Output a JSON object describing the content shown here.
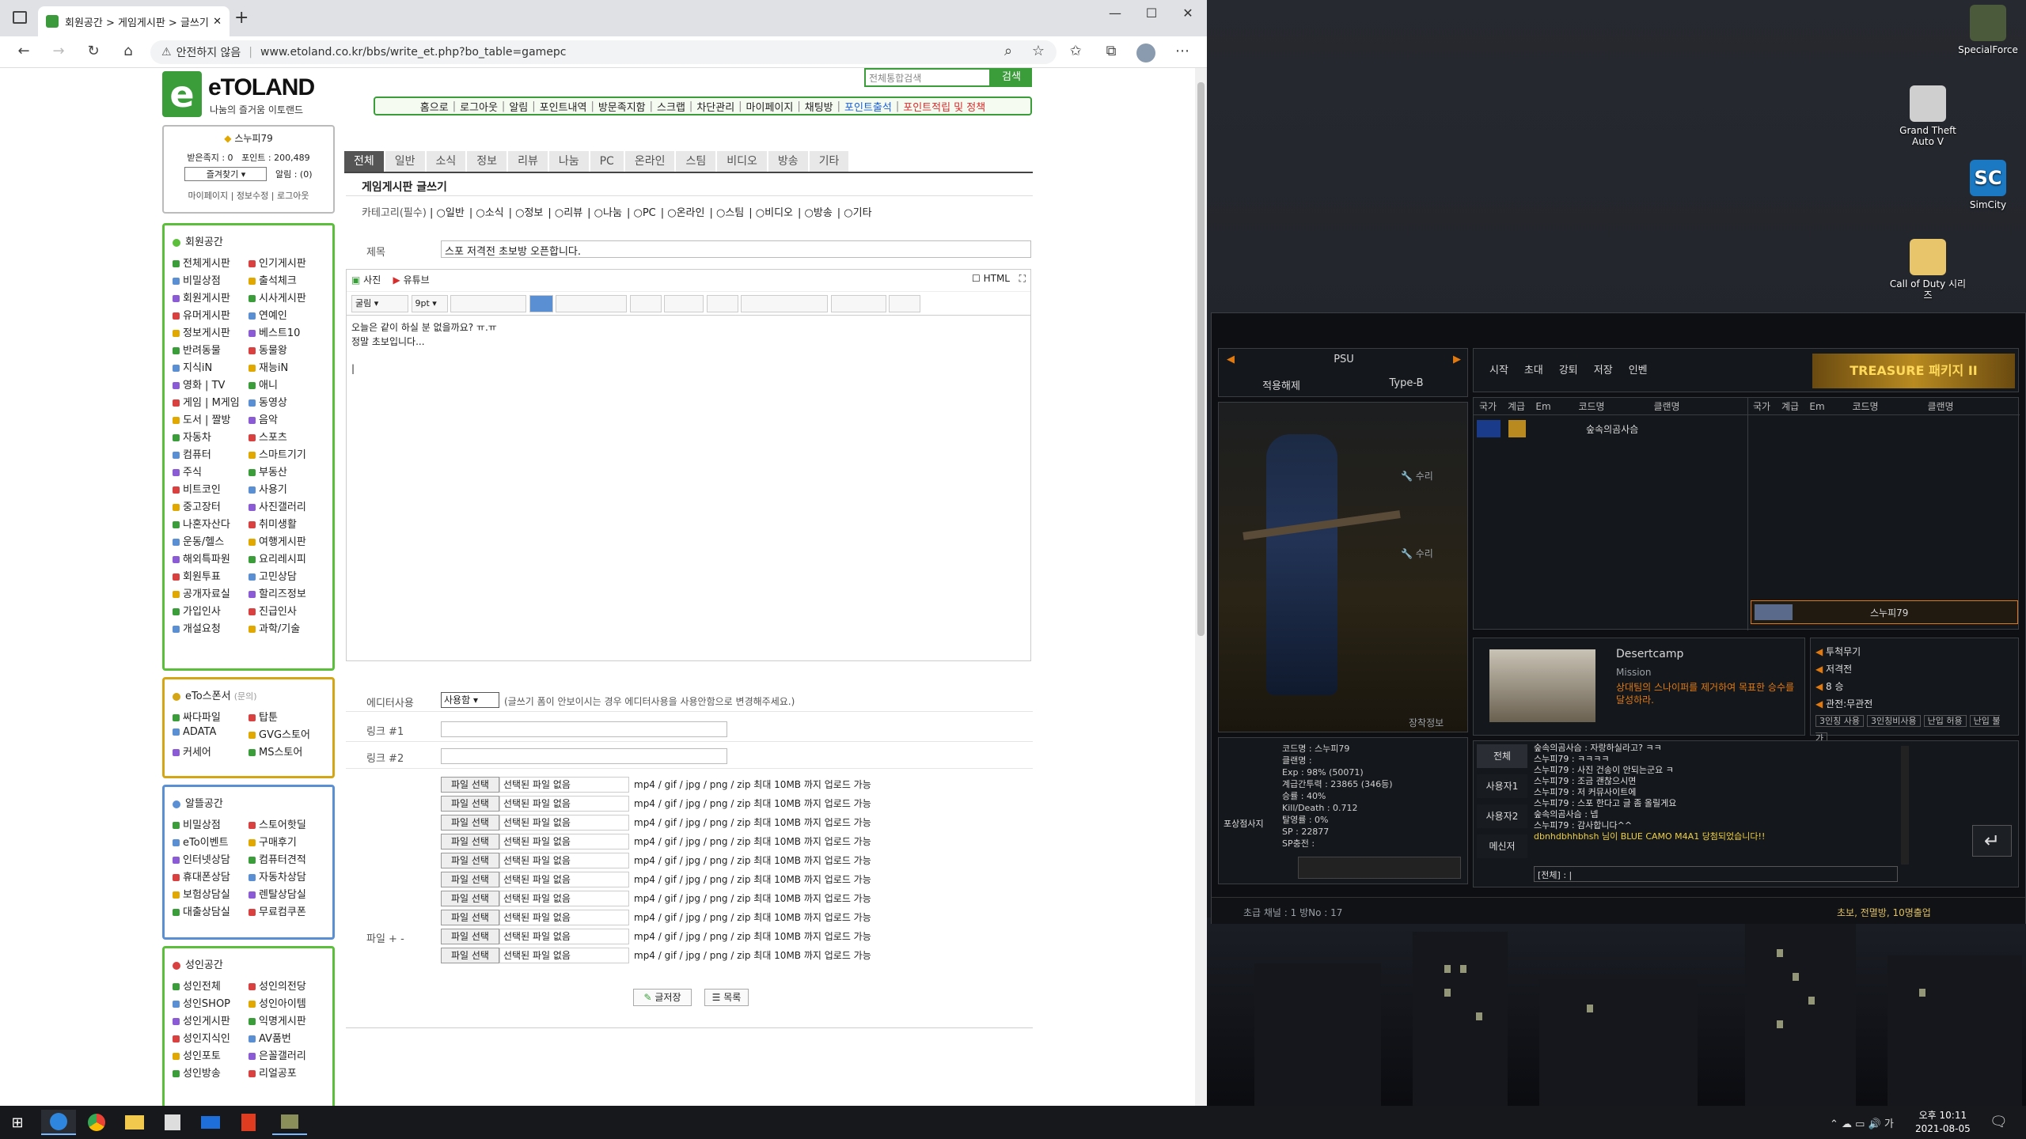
{
  "browser": {
    "tab_title": "회원공간 > 게임게시판 > 글쓰기",
    "new_tab": "+",
    "url_warning": "안전하지 않음",
    "url": "www.etoland.co.kr/bbs/write_et.php?bo_table=gamepc"
  },
  "site": {
    "logo_letter": "e",
    "logo_name": "eTOLAND",
    "logo_sub": "나눔의 즐거움 이토랜드",
    "search_placeholder": "전체통합검색",
    "search_button": "검색",
    "nav": [
      "홈으로",
      "로그아웃",
      "알림",
      "포인트내역",
      "방문족지함",
      "스크랩",
      "차단관리",
      "마이페이지",
      "채팅방",
      "포인트출석",
      "포인트적립 및 정책"
    ]
  },
  "user": {
    "name": "스누피79",
    "received_label": "받은족지 : 0",
    "points_label": "포인트 : 200,489",
    "favorites": "즐겨찾기",
    "alerts": "알림 : (0)",
    "links": "마이페이지 | 정보수정 | 로그아웃"
  },
  "sidebar": {
    "member": {
      "title": "회원공간",
      "items": [
        "전체게시판",
        "인기게시판",
        "비밀상점",
        "출석체크",
        "회원게시판",
        "시사게시판",
        "유머게시판",
        "연예인",
        "정보게시판",
        "베스트10",
        "반려동물",
        "동물왕",
        "지식iN",
        "재능iN",
        "영화 | TV",
        "애니",
        "게임 | M게임",
        "동영상",
        "도서 | 짤방",
        "음악",
        "자동차",
        "스포츠",
        "컴퓨터",
        "스마트기기",
        "주식",
        "부동산",
        "비트코인",
        "사용기",
        "중고장터",
        "사진갤러리",
        "나혼자산다",
        "취미생활",
        "운동/헬스",
        "여행게시판",
        "해외특파원",
        "요리레시피",
        "회원투표",
        "고민상담",
        "공개자료실",
        "할리즈정보",
        "가입인사",
        "진급인사",
        "개설요청",
        "과학/기술"
      ]
    },
    "sponsor": {
      "title": "eTo스폰서",
      "sub": "(문의)",
      "items": [
        "싸다파일",
        "탑툰",
        "ADATA",
        "GVG스토어",
        "커세어",
        "MS스토어"
      ]
    },
    "deals": {
      "title": "알뜰공간",
      "items": [
        "비밀상점",
        "스토어핫딜",
        "eTo이벤트",
        "구매후기",
        "인터넷상담",
        "컴퓨터견적",
        "휴대폰상담",
        "자동차상담",
        "보험상담실",
        "렌탈상담실",
        "대출상담실",
        "무료컴쿠폰"
      ]
    },
    "adult": {
      "title": "성인공간",
      "items": [
        "성인전체",
        "성인의전당",
        "성인SHOP",
        "성인아이템",
        "성인게시판",
        "익명게시판",
        "성인지식인",
        "AV품번",
        "성인포토",
        "은꼴갤러리",
        "성인방송",
        "리얼공포"
      ]
    }
  },
  "board": {
    "tabs": [
      "전체",
      "일반",
      "소식",
      "정보",
      "리뷰",
      "나눔",
      "PC",
      "온라인",
      "스팀",
      "비디오",
      "방송",
      "기타"
    ],
    "heading": "게임게시판 글쓰기",
    "category_label": "카테고리(필수)",
    "categories": [
      "일반",
      "소식",
      "정보",
      "리뷰",
      "나눔",
      "PC",
      "온라인",
      "스팀",
      "비디오",
      "방송",
      "기타"
    ],
    "subject_label": "제목",
    "subject": "스포 저격전 초보방 오픈합니다.",
    "photo_btn": "사진",
    "youtube_btn": "유튜브",
    "html_label": "HTML",
    "font_select": "굴림",
    "size_select": "9pt",
    "body_line1": "오늘은 같이 하실 분 없을까요? ㅠ.ㅠ",
    "body_line2": "정말 초보입니다...",
    "editor_label": "에디터사용",
    "editor_select": "사용함",
    "editor_hint": "(글쓰기 폼이 안보이시는 경우 에디터사용을 사용안함으로 변경해주세요.)",
    "link1_label": "링크 #1",
    "link2_label": "링크 #2",
    "file_label": "파일 + -",
    "file_button": "파일 선택",
    "file_none": "선택된 파일 없음",
    "file_hint": "mp4 / gif / jpg / png / zip 최대 10MB 까지 업로드 가능",
    "save_btn": "글저장",
    "list_btn": "목록"
  },
  "game": {
    "server": "PSU",
    "mode_left": "적용해제",
    "mode_right": "Type-B",
    "repair": "수리",
    "equip": "장착정보",
    "toolbar": [
      "시작",
      "초대",
      "강퇴",
      "저장",
      "인벤"
    ],
    "banner": "TREASURE 패키지 II",
    "cols": [
      "국가",
      "계급",
      "Em",
      "코드명",
      "클랜명"
    ],
    "cols_right": [
      "국가",
      "계급",
      "Em",
      "코드명",
      "클랜명"
    ],
    "player_left": "숲속의곰사슴",
    "player_right": "스누피79",
    "map_name": "Desertcamp",
    "map_mode": "Mission",
    "map_desc": "상대팀의 스나이퍼를 제거하여 목표한 승수를 달성하라.",
    "right_opts": [
      "투척무기",
      "저격전",
      "8 승",
      "관전:무관전"
    ],
    "right_btns": [
      "3인칭 사용",
      "3인칭비사용",
      "난입 허용",
      "난입 불가"
    ],
    "stats": [
      "코드명 : 스누피79",
      "클랜명 :",
      "Exp : 98% (50071)",
      "계급간투력 : 23865 (346등)",
      "승률 : 40%",
      "Kill/Death : 0.712",
      "탈영률 : 0%",
      "SP : 22877",
      "SP충전 :"
    ],
    "badge": "포상점사지",
    "chat_tabs": [
      "전체",
      "사용자1",
      "사용자2",
      "메신저"
    ],
    "chat": [
      "숲속의곰사슴 : 자랑하실라고? ㅋㅋ",
      "스누피79 : ㅋㅋㅋㅋ",
      "스누피79 : 사진 건송이 안되는군요 ㅋ",
      "스누피79 : 조금 괜찮으시면",
      "스누피79 : 저 커뮤사이트에",
      "스누피79 : 스포 한다고 글 좀 올릴게요",
      "숲속의곰사슴 : 넵",
      "스누피79 : 감사합니다^^",
      "dbnhdbhhbhsh 님이 BLUE CAMO M4A1 당첨되었습니다!!"
    ],
    "chat_input": "[전체] : |",
    "status_left": "초급  채널 : 1  방No : 17",
    "status_right": "초보, 전멸방, 10명출업"
  },
  "desktop": {
    "icons": [
      "SpecialForce",
      "Grand Theft Auto V",
      "SimCity",
      "Call of Duty 시리즈"
    ]
  },
  "taskbar": {
    "time": "오후 10:11",
    "date": "2021-08-05",
    "lang": "가"
  },
  "colors": {
    "accent": "#3a9d3a",
    "nav_border": "#3a9d3a",
    "sidebox_green": "#5bbf3b",
    "sidebox_gold": "#d4a514",
    "sidebox_blue": "#5b8fd4",
    "game_orange": "#e07a10"
  }
}
